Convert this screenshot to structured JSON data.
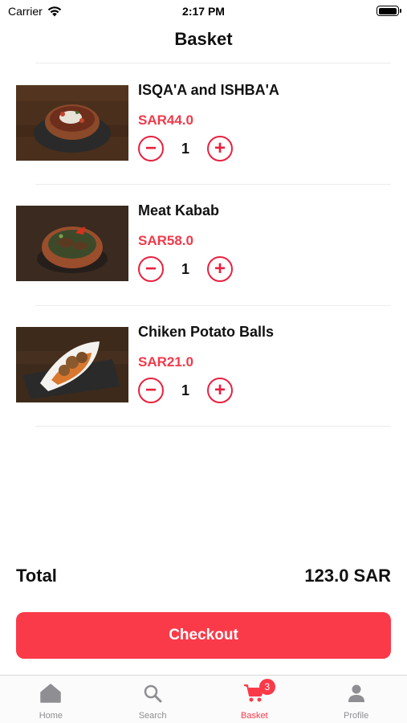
{
  "status_bar": {
    "carrier": "Carrier",
    "time": "2:17 PM",
    "battery_level": 1.0
  },
  "header": {
    "title": "Basket"
  },
  "items": [
    {
      "name": "ISQA'A and ISHBA'A",
      "price": "SAR44.0",
      "quantity": "1",
      "image": "food-photo"
    },
    {
      "name": "Meat Kabab",
      "price": "SAR58.0",
      "quantity": "1",
      "image": "food-photo"
    },
    {
      "name": "Chiken Potato Balls",
      "price": "SAR21.0",
      "quantity": "1",
      "image": "food-photo"
    }
  ],
  "qty_controls": {
    "minus": "−",
    "plus": "+"
  },
  "summary": {
    "total_label": "Total",
    "total_value": "123.0 SAR"
  },
  "checkout": {
    "label": "Checkout"
  },
  "tab_bar": {
    "tabs": [
      {
        "label": "Home",
        "icon": "home-icon"
      },
      {
        "label": "Search",
        "icon": "search-icon"
      },
      {
        "label": "Basket",
        "icon": "cart-icon",
        "badge": "3",
        "active": true
      },
      {
        "label": "Profile",
        "icon": "person-icon"
      }
    ]
  },
  "colors": {
    "accent": "#fb3a49",
    "qty_button": "#e8213f",
    "price": "#f03a4a",
    "inactive_tab": "#8e8e93"
  }
}
